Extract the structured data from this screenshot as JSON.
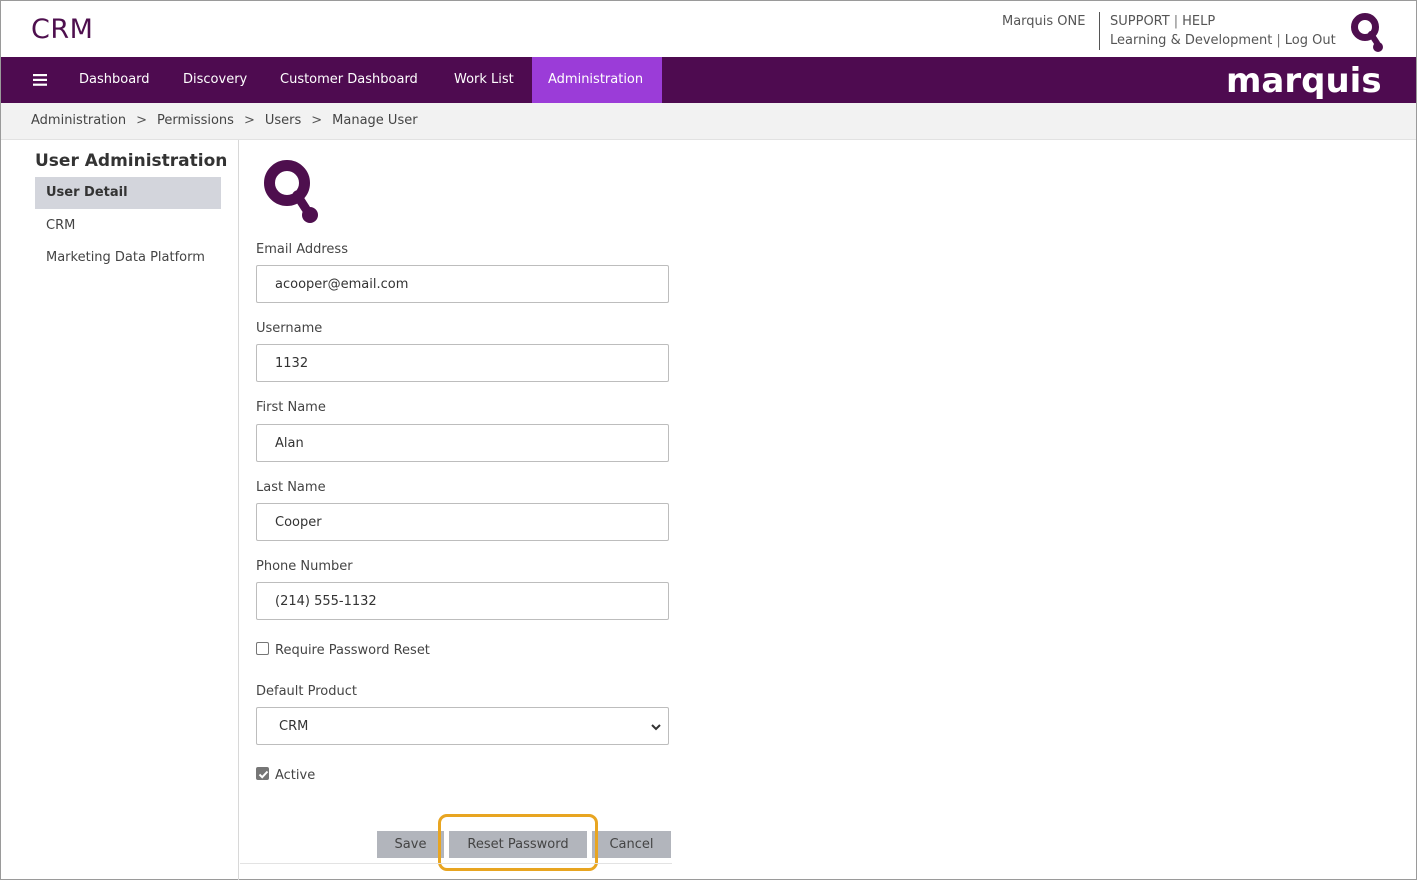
{
  "header": {
    "app_title": "CRM",
    "links": {
      "marquis_one": "Marquis ONE",
      "support": "SUPPORT",
      "help": "HELP",
      "learning": "Learning & Development",
      "logout": "Log Out",
      "separator": "|"
    },
    "icon": "marquis-q-icon"
  },
  "nav": {
    "menu_icon": "hamburger-icon",
    "items": [
      {
        "label": "Dashboard"
      },
      {
        "label": "Discovery"
      },
      {
        "label": "Customer Dashboard"
      },
      {
        "label": "Work List"
      },
      {
        "label": "Administration",
        "active": true
      }
    ],
    "brand": "marquis",
    "colors": {
      "bar": "#4e0b50",
      "active": "#9b3cd8"
    }
  },
  "breadcrumb": {
    "items": [
      "Administration",
      "Permissions",
      "Users",
      "Manage User"
    ],
    "separator": ">"
  },
  "sidebar": {
    "title": "User Administration",
    "items": [
      {
        "label": "User Detail",
        "active": true
      },
      {
        "label": "CRM"
      },
      {
        "label": "Marketing Data Platform"
      }
    ]
  },
  "form": {
    "logo_icon": "marquis-q-icon",
    "email": {
      "label": "Email Address",
      "value": "acooper@email.com"
    },
    "username": {
      "label": "Username",
      "value": "1132"
    },
    "first_name": {
      "label": "First Name",
      "value": "Alan"
    },
    "last_name": {
      "label": "Last Name",
      "value": "Cooper"
    },
    "phone": {
      "label": "Phone Number",
      "value": "(214) 555-1132"
    },
    "require_reset": {
      "label": "Require Password Reset",
      "checked": false
    },
    "default_product": {
      "label": "Default Product",
      "value": "CRM"
    },
    "active": {
      "label": "Active",
      "checked": true
    },
    "buttons": {
      "save": "Save",
      "reset_password": "Reset Password",
      "cancel": "Cancel"
    },
    "highlight_color": "#e8a521"
  }
}
